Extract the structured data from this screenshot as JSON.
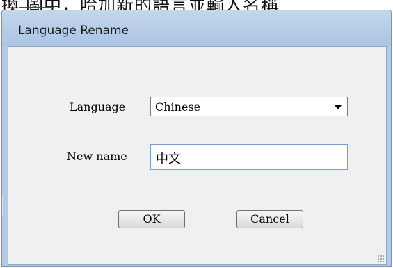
{
  "background": {
    "cropped_text": "換 圖中，哈加新的語言並輸入名稱"
  },
  "dialog": {
    "title": "Language Rename",
    "language_label": "Language",
    "language_selected": "Chinese",
    "new_name_label": "New name",
    "new_name_value": "中文",
    "ok_label": "OK",
    "cancel_label": "Cancel"
  },
  "colors": {
    "titlebar": "#b4cbe7",
    "client_bg": "#f0f0f0",
    "link": "#1f4fa6"
  },
  "icons": {
    "dropdown": "chevron-down-icon",
    "resize": "resize-grip-icon"
  }
}
